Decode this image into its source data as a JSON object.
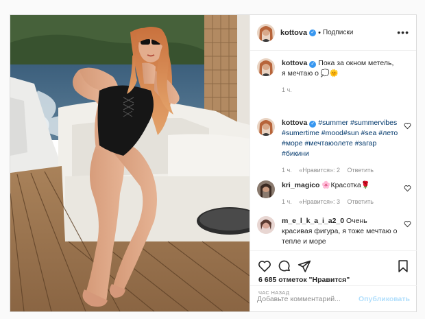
{
  "post": {
    "author": "kottova",
    "header_separator": "•",
    "follow_label": "Подписки",
    "more_label": "•••"
  },
  "comments": [
    {
      "user": "kottova",
      "text": "Пока за окном метель, я мечтаю о 💭🌞",
      "time": "1 ч.",
      "likes": "",
      "reply": ""
    },
    {
      "user": "kottova",
      "text": "#summer #summervibes #sumertime #mood#sun #sea #лето #море #мечтаюолете #загар #бикини",
      "time": "1 ч.",
      "likes": "«Нравится»: 2",
      "reply": "Ответить"
    },
    {
      "user": "kri_magico",
      "text": "🌸Красотка🌹",
      "time": "1 ч.",
      "likes": "«Нравится»: 3",
      "reply": "Ответить"
    },
    {
      "user": "m_e_l_k_a_i_a2_0",
      "text": "Очень красивая фигура, я тоже мечтаю о тепле и море",
      "time": "",
      "likes": "",
      "reply": ""
    }
  ],
  "stats": {
    "likes_line": "6 685 отметок \"Нравится\"",
    "posted_ago": "ЧАС НАЗАД"
  },
  "add_comment": {
    "placeholder": "Добавьте комментарий...",
    "publish_label": "Опубликовать"
  },
  "icons": {
    "like": "heart-icon",
    "comment": "comment-bubble-icon",
    "share": "paper-plane-icon",
    "save": "bookmark-icon",
    "verified": "verified-badge-icon"
  },
  "colors": {
    "link": "#00376b",
    "verified": "#3897f0",
    "muted": "#8e8e8e",
    "publish_disabled": "#b2dffc"
  }
}
